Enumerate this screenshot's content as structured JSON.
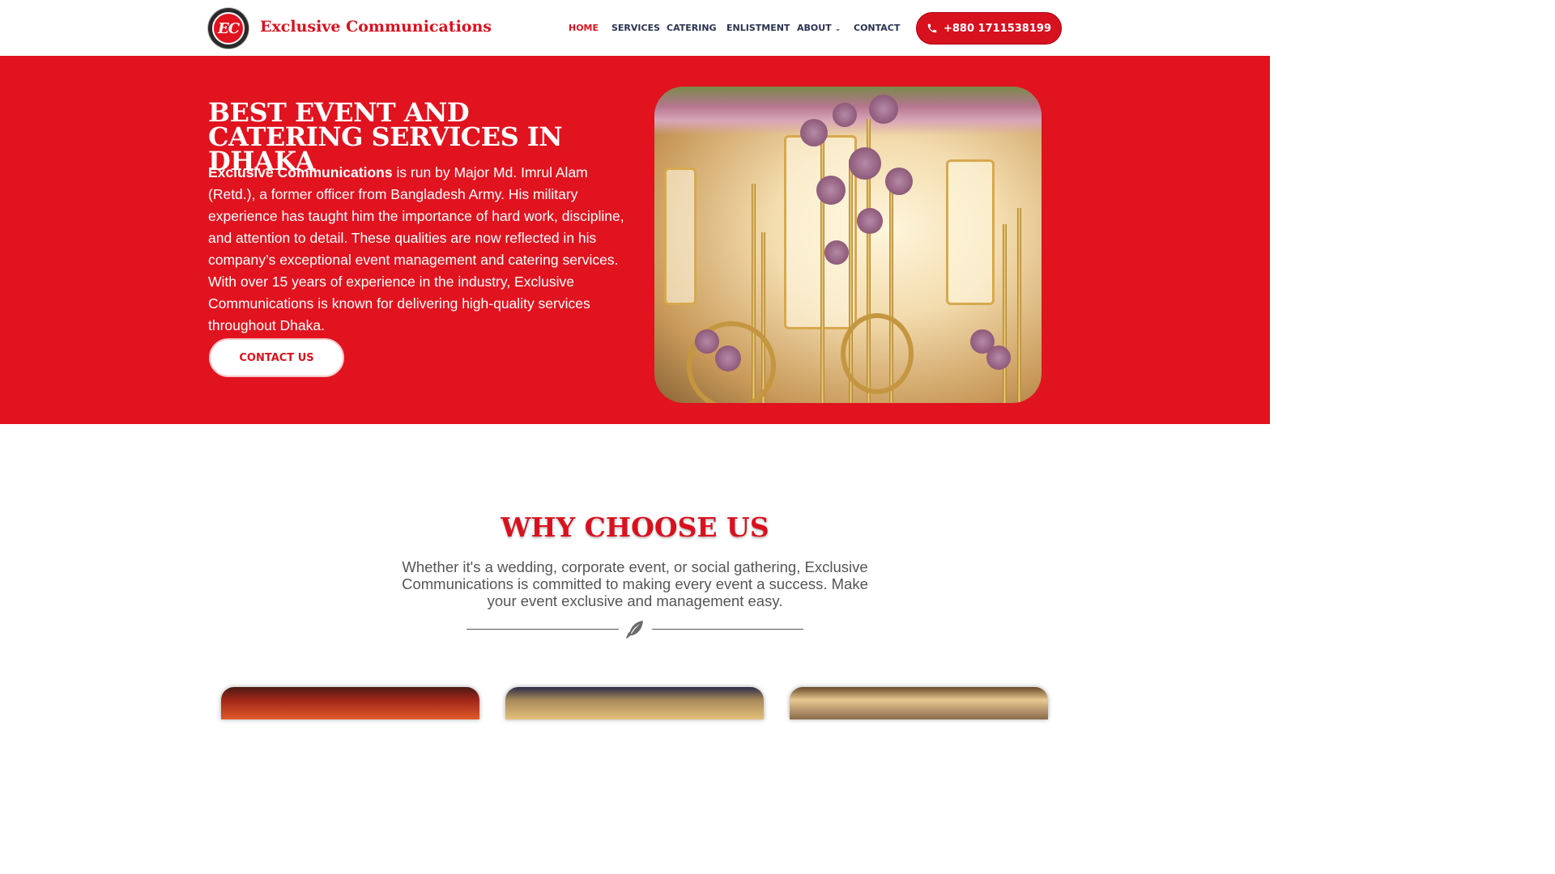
{
  "header": {
    "logo_text": "EC",
    "brand": "Exclusive Communications",
    "nav": [
      {
        "label": "HOME",
        "active": true
      },
      {
        "label": "SERVICES",
        "active": false
      },
      {
        "label": "CATERING",
        "active": false
      },
      {
        "label": "ENLISTMENT",
        "active": false
      },
      {
        "label": "ABOUT",
        "active": false,
        "has_dropdown": true
      },
      {
        "label": "CONTACT",
        "active": false
      }
    ],
    "phone": "+880 1711538199",
    "phone_icon": "phone-icon"
  },
  "hero": {
    "title": "BEST EVENT AND CATERING SERVICES IN DHAKA",
    "text_bold": "Exclusive Communications",
    "text_rest": " is run by Major Md. Imrul Alam (Retd.), a former officer from Bangladesh Army. His military experience has taught him the importance of hard work, discipline, and attention to detail. These qualities are now reflected in his company’s exceptional event management and catering services. With over 15 years of experience in the industry, Exclusive Communications is known for delivering high-quality services throughout Dhaka.",
    "cta": "CONTACT US",
    "image": "event-decoration-photo"
  },
  "why": {
    "title": "WHY CHOOSE US",
    "text": "Whether it's a wedding, corporate event, or social gathering, Exclusive Communications is committed to making every event a success. Make your event exclusive and management easy.",
    "divider_icon": "feather-icon"
  },
  "colors": {
    "brand_red": "#d8111e",
    "hero_red": "#e0131f",
    "nav_text": "#2a3350"
  }
}
